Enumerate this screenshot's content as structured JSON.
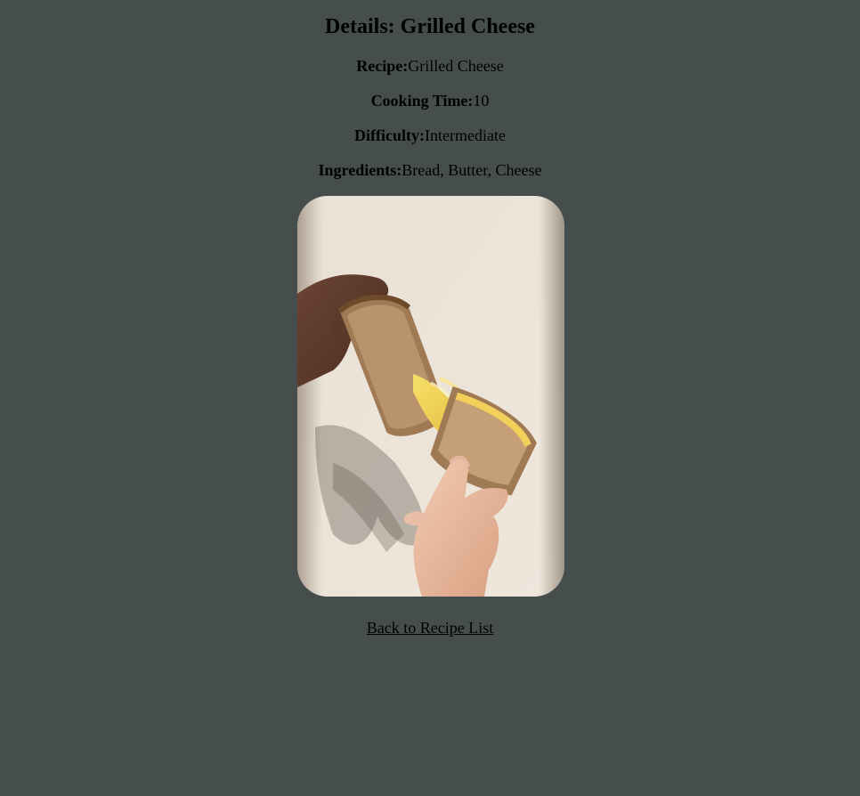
{
  "page": {
    "title": "Details: Grilled Cheese",
    "background_color": "#464e4d"
  },
  "details": {
    "recipe_label": "Recipe:",
    "recipe_value": "Grilled Cheese",
    "time_label": "Cooking Time:",
    "time_value": "10",
    "difficulty_label": "Difficulty:",
    "difficulty_value": "Intermediate",
    "ingredients_label": "Ingredients:",
    "ingredients_value": "Bread, Butter, Cheese"
  },
  "image": {
    "alt": "Grilled Cheese"
  },
  "nav": {
    "back_label": "Back to Recipe List"
  }
}
